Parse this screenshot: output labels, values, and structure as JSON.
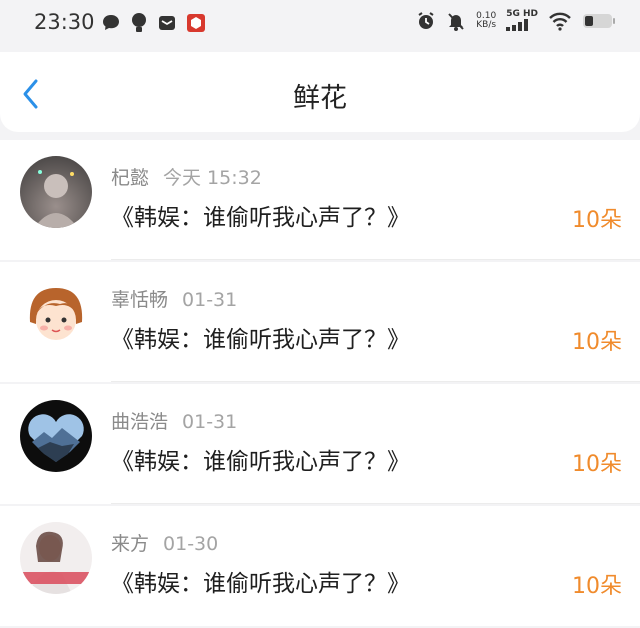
{
  "status": {
    "time": "23:30",
    "net_speed": "0.10",
    "net_unit": "KB/s",
    "signal_label": "5G HD"
  },
  "header": {
    "title": "鲜花"
  },
  "colors": {
    "accent": "#2b90e8",
    "flower": "#f08b2c"
  },
  "entries": [
    {
      "name": "杞懿",
      "date": "今天 15:32",
      "book": "《韩娱：谁偷听我心声了？》",
      "flowers": "10朵"
    },
    {
      "name": "辜恬畅",
      "date": "01-31",
      "book": "《韩娱：谁偷听我心声了？》",
      "flowers": "10朵"
    },
    {
      "name": "曲浩浩",
      "date": "01-31",
      "book": "《韩娱：谁偷听我心声了？》",
      "flowers": "10朵"
    },
    {
      "name": "来方",
      "date": "01-30",
      "book": "《韩娱：谁偷听我心声了？》",
      "flowers": "10朵"
    }
  ]
}
